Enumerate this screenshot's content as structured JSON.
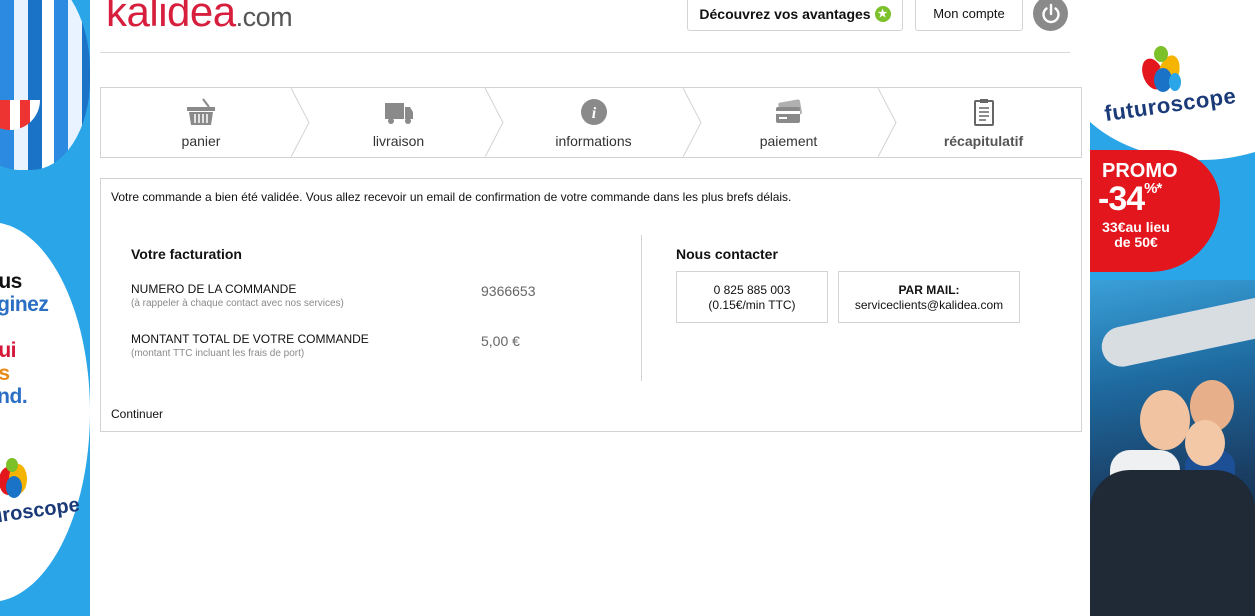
{
  "header": {
    "logo_main": "kalidea",
    "logo_suffix": ".com",
    "avantages_label": "Découvrez vos avantages",
    "compte_label": "Mon compte"
  },
  "steps": [
    {
      "label": "panier",
      "icon": "basket-icon"
    },
    {
      "label": "livraison",
      "icon": "truck-icon"
    },
    {
      "label": "informations",
      "icon": "info-icon"
    },
    {
      "label": "paiement",
      "icon": "credit-card-icon"
    },
    {
      "label": "récapitulatif",
      "icon": "clipboard-icon",
      "active": true
    }
  ],
  "confirmation": {
    "message": "Votre commande a bien été validée. Vous allez recevoir un email de confirmation de votre commande dans les plus brefs délais.",
    "billing_title": "Votre facturation",
    "order_number_label": "NUMERO DE LA COMMANDE",
    "order_number_hint": "(à rappeler à chaque contact avec nos services)",
    "order_number_value": "9366653",
    "total_label": "MONTANT TOTAL DE VOTRE COMMANDE",
    "total_hint": "(montant TTC incluant les frais de port)",
    "total_value": "5,00 €",
    "contact_title": "Nous contacter",
    "phone_number": "0 825 885 003",
    "phone_rate": "(0.15€/min TTC)",
    "mail_label": "PAR MAIL:",
    "mail_address": "serviceclients@kalidea.com",
    "continue_label": "Continuer"
  },
  "ad_left": {
    "slogan_lines": [
      "ous",
      "aginez",
      "s",
      "qui",
      "us",
      "end."
    ],
    "brand": "uroscope"
  },
  "ad_right": {
    "brand": "futuroscope",
    "promo_word": "PROMO",
    "promo_value": "-34",
    "promo_unit": "%*",
    "promo_price_line1": "33€au lieu",
    "promo_price_line2": "de 50€"
  },
  "colors": {
    "brand_red": "#d71f3d",
    "accent_green": "#7cc02a",
    "ad_blue": "#2aa6e8",
    "promo_red": "#e3161e"
  }
}
